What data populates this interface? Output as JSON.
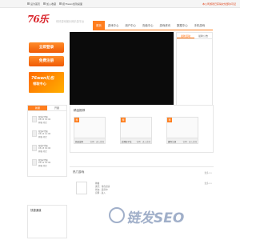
{
  "topbar": {
    "links": [
      "设为首页",
      "加入收藏",
      "把76wan加到桌面"
    ],
    "notice": "本公司游戏已获得文化部许可证"
  },
  "brand": {
    "logo_text": "76乐",
    "slogan": "你好游戏娱乐网手游平台"
  },
  "nav": {
    "items": [
      "首页",
      "游戏中心",
      "用户中心",
      "充值中心",
      "游戏资讯",
      "数据中心",
      "手机游戏"
    ]
  },
  "sidebar": {
    "login_label": "立即登录",
    "register_label": "免费注册",
    "gift_line1": "76wan礼包",
    "gift_line2": "领取中心"
  },
  "right_panel": {
    "tabs": [
      "最新活动",
      "最新公告"
    ]
  },
  "server_box": {
    "tabs": [
      "新服",
      "开服"
    ],
    "servers": [
      {
        "line1": "双线2代服",
        "line2": "03-15 12:00",
        "line3": "开服 待定"
      },
      {
        "line1": "双线2代服",
        "line2": "03-14 11:00",
        "line3": "开服 待定"
      },
      {
        "line1": "双线2代服",
        "line2": "03-13 10:00",
        "line3": "开服 待定"
      },
      {
        "line1": "双线2代服",
        "line2": "03-12 12:00",
        "line3": "开服 待定"
      }
    ]
  },
  "recommend": {
    "title": "精品推荐",
    "cards": [
      {
        "tag": "荐",
        "name": "热血战场",
        "link": "官网 · 进入游戏"
      },
      {
        "tag": "荐",
        "name": "武神赵子龙",
        "link": "官网 · 进入游戏"
      },
      {
        "tag": "荐",
        "name": "傲剑江湖",
        "link": "官网 · 进入游戏"
      }
    ]
  },
  "hot": {
    "title": "热门游戏",
    "more": "更多>>",
    "name": "神曲",
    "lines": [
      "类型：角色扮演",
      "状态：运营中",
      "官网 · 进入"
    ]
  },
  "quick": {
    "title": "快捷通道"
  },
  "watermark": {
    "text": "链发SEO"
  },
  "colors": {
    "accent": "#ff7e1e",
    "brand_red": "#d9242b",
    "video_bg": "#0b0b0b"
  }
}
